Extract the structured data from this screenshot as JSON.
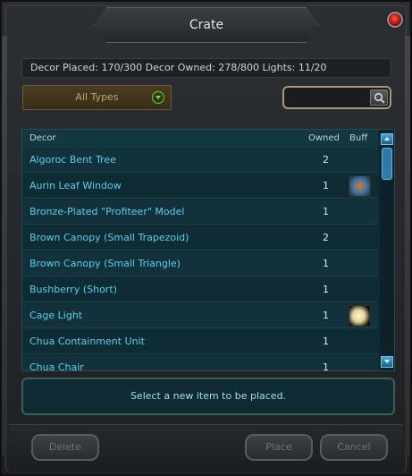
{
  "window": {
    "title": "Crate"
  },
  "stats": {
    "text": "Decor Placed: 170/300   Decor Owned: 278/800   Lights: 11/20"
  },
  "filter": {
    "selected": "All Types"
  },
  "search": {
    "value": "",
    "placeholder": ""
  },
  "list": {
    "headers": {
      "decor": "Decor",
      "owned": "Owned",
      "buff": "Buff"
    },
    "rows": [
      {
        "name": "Algoroc Bent Tree",
        "owned": "2",
        "buff": null
      },
      {
        "name": "Aurin Leaf Window",
        "owned": "1",
        "buff": "window-buff-icon"
      },
      {
        "name": "Bronze-Plated \"Profiteer\" Model",
        "owned": "1",
        "buff": null
      },
      {
        "name": "Brown Canopy (Small Trapezoid)",
        "owned": "2",
        "buff": null
      },
      {
        "name": "Brown Canopy (Small Triangle)",
        "owned": "1",
        "buff": null
      },
      {
        "name": "Bushberry (Short)",
        "owned": "1",
        "buff": null
      },
      {
        "name": "Cage Light",
        "owned": "1",
        "buff": "light-buff-icon"
      },
      {
        "name": "Chua Containment Unit",
        "owned": "1",
        "buff": null
      },
      {
        "name": "Chua Chair",
        "owned": "1",
        "buff": null
      }
    ]
  },
  "status": {
    "message": "Select a new item to be placed."
  },
  "buttons": {
    "delete": "Delete",
    "place": "Place",
    "cancel": "Cancel"
  }
}
